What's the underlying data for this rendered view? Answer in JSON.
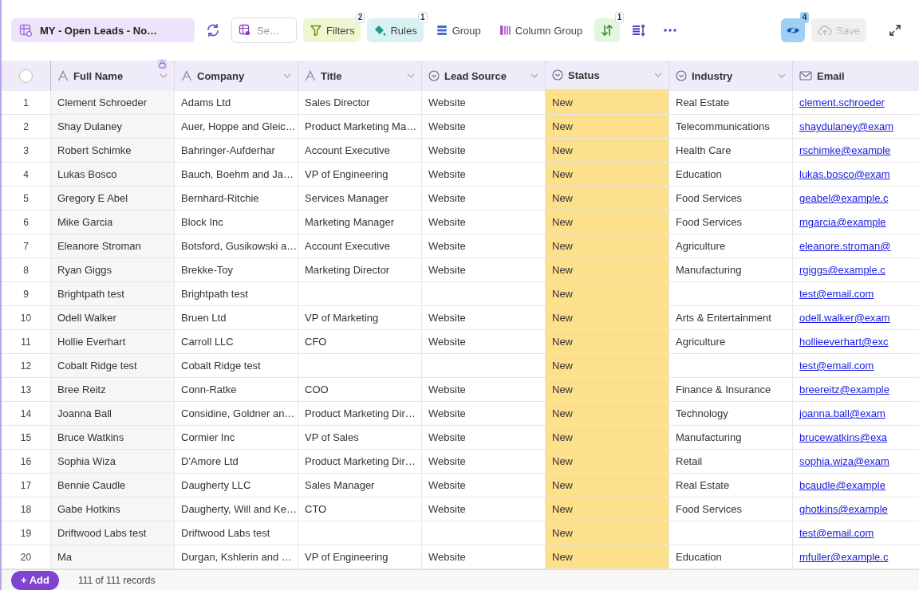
{
  "toolbar": {
    "view": "MY - Open Leads - No…",
    "search_placeholder": "Se…",
    "buttons": [
      {
        "kind": "filter",
        "label": "Filters",
        "badge": "2"
      },
      {
        "kind": "rules",
        "label": "Rules",
        "badge": "1"
      },
      {
        "kind": "group",
        "label": "Group"
      },
      {
        "kind": "column-group",
        "label": "Column Group"
      },
      {
        "kind": "sort",
        "badge": "1"
      },
      {
        "kind": "row-height"
      },
      {
        "kind": "more"
      }
    ],
    "hidden_fields_badge": "4",
    "save": {
      "label": "Save",
      "disabled": true
    }
  },
  "select_all": {
    "checked": false
  },
  "columns": [
    {
      "label": "Full Name",
      "kind": "text",
      "locked": true,
      "highlighted": false
    },
    {
      "label": "Company",
      "kind": "text",
      "locked": false,
      "highlighted": false
    },
    {
      "label": "Title",
      "kind": "text",
      "locked": false,
      "highlighted": false
    },
    {
      "label": "Lead Source",
      "kind": "select",
      "locked": false,
      "highlighted": false
    },
    {
      "label": "Status",
      "kind": "select",
      "locked": false,
      "highlighted": true
    },
    {
      "label": "Industry",
      "kind": "select",
      "locked": false,
      "highlighted": false
    },
    {
      "label": "Email",
      "kind": "email",
      "locked": false,
      "highlighted": false
    }
  ],
  "rows": [
    {
      "number": "1",
      "cells": [
        "Clement Schroeder",
        "Adams Ltd",
        "Sales Director",
        "Website",
        "New",
        "Real Estate",
        "clement.schroeder"
      ]
    },
    {
      "number": "2",
      "cells": [
        "Shay Dulaney",
        "Auer, Hoppe and Gleic…",
        "Product Marketing Ma…",
        "Website",
        "New",
        "Telecommunications",
        "shaydulaney@exam"
      ]
    },
    {
      "number": "3",
      "cells": [
        "Robert Schimke",
        "Bahringer-Aufderhar",
        "Account Executive",
        "Website",
        "New",
        "Health Care",
        "rschimke@example"
      ]
    },
    {
      "number": "4",
      "cells": [
        "Lukas Bosco",
        "Bauch, Boehm and Ja…",
        "VP of Engineering",
        "Website",
        "New",
        "Education",
        "lukas.bosco@exam"
      ]
    },
    {
      "number": "5",
      "cells": [
        "Gregory E Abel",
        "Bernhard-Ritchie",
        "Services Manager",
        "Website",
        "New",
        "Food Services",
        "geabel@example.c"
      ]
    },
    {
      "number": "6",
      "cells": [
        "Mike Garcia",
        "Block Inc",
        "Marketing Manager",
        "Website",
        "New",
        "Food Services",
        "mgarcia@example"
      ]
    },
    {
      "number": "7",
      "cells": [
        "Eleanore Stroman",
        "Botsford, Gusikowski a…",
        "Account Executive",
        "Website",
        "New",
        "Agriculture",
        "eleanore.stroman@"
      ]
    },
    {
      "number": "8",
      "cells": [
        "Ryan Giggs",
        "Brekke-Toy",
        "Marketing Director",
        "Website",
        "New",
        "Manufacturing",
        "rgiggs@example.c"
      ]
    },
    {
      "number": "9",
      "cells": [
        "Brightpath test",
        "Brightpath test",
        "",
        "",
        "New",
        "",
        "test@email.com"
      ]
    },
    {
      "number": "10",
      "cells": [
        "Odell Walker",
        "Bruen Ltd",
        "VP of Marketing",
        "Website",
        "New",
        "Arts & Entertainment",
        "odell.walker@exam"
      ]
    },
    {
      "number": "11",
      "cells": [
        "Hollie Everhart",
        "Carroll LLC",
        "CFO",
        "Website",
        "New",
        "Agriculture",
        "hollieeverhart@exc"
      ]
    },
    {
      "number": "12",
      "cells": [
        "Cobalt Ridge test",
        "Cobalt Ridge test",
        "",
        "",
        "New",
        "",
        "test@email.com"
      ]
    },
    {
      "number": "13",
      "cells": [
        "Bree Reitz",
        "Conn-Ratke",
        "COO",
        "Website",
        "New",
        "Finance & Insurance",
        "breereitz@example"
      ]
    },
    {
      "number": "14",
      "cells": [
        "Joanna Ball",
        "Considine, Goldner an…",
        "Product Marketing Dir…",
        "Website",
        "New",
        "Technology",
        "joanna.ball@exam"
      ]
    },
    {
      "number": "15",
      "cells": [
        "Bruce Watkins",
        "Cormier Inc",
        "VP of Sales",
        "Website",
        "New",
        "Manufacturing",
        "brucewatkins@exa"
      ]
    },
    {
      "number": "16",
      "cells": [
        "Sophia Wiza",
        "D'Amore Ltd",
        "Product Marketing Dir…",
        "Website",
        "New",
        "Retail",
        "sophia.wiza@exam"
      ]
    },
    {
      "number": "17",
      "cells": [
        "Bennie Caudle",
        "Daugherty LLC",
        "Sales Manager",
        "Website",
        "New",
        "Real Estate",
        "bcaudle@example"
      ]
    },
    {
      "number": "18",
      "cells": [
        "Gabe Hotkins",
        "Daugherty, Will and Ke…",
        "CTO",
        "Website",
        "New",
        "Food Services",
        "ghotkins@example"
      ]
    },
    {
      "number": "19",
      "cells": [
        "Driftwood Labs test",
        "Driftwood Labs test",
        "",
        "",
        "New",
        "",
        "test@email.com"
      ]
    },
    {
      "number": "20",
      "cells": [
        "Ma",
        "Durgan, Kshlerin and …",
        "VP of Engineering",
        "Website",
        "New",
        "Education",
        "mfuller@example.c"
      ]
    }
  ],
  "footer": {
    "add_label": "+ Add",
    "record_count": "111 of 111 records"
  }
}
